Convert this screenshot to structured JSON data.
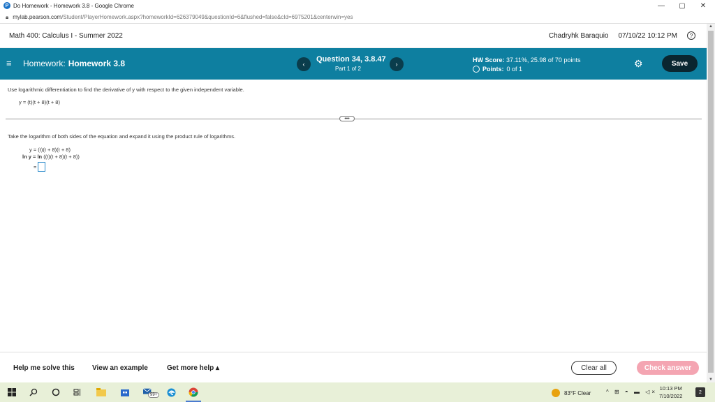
{
  "browser": {
    "window_title": "Do Homework - Homework 3.8 - Google Chrome",
    "url_domain": "mylab.pearson.com",
    "url_path": "/Student/PlayerHomework.aspx?homeworkId=626379049&questionId=6&flushed=false&cId=6975201&centerwin=yes",
    "minimize": "—",
    "restore": "▢",
    "close": "✕"
  },
  "course": {
    "name": "Math 400: Calculus I - Summer 2022",
    "user": "Chadryhk Baraquio",
    "datetime": "07/10/22 10:12 PM",
    "help": "?"
  },
  "header": {
    "menu_icon": "≡",
    "hw_prefix": "Homework:",
    "hw_name": "Homework 3.8",
    "prev": "‹",
    "next": "›",
    "question": "Question 34, 3.8.47",
    "part": "Part 1 of 2",
    "score_label": "HW Score:",
    "score_value": "37.11%, 25.98 of 70 points",
    "points_label": "Points:",
    "points_value": "0 of 1",
    "gear": "⚙",
    "save": "Save"
  },
  "question": {
    "instruction": "Use logarithmic differentiation to find the derivative of y with respect to the given independent variable.",
    "equation": "y = (t)(t + 8)(t + 8)",
    "expand_handle": "•••",
    "step_instruction": "Take the logarithm of both sides of the equation and expand it using the product rule of logarithms.",
    "line1": "y = (t)(t + 8)(t + 8)",
    "line2_prefix": "ln y = ",
    "line2_ln": "ln",
    "line2_rest": " ((t)(t + 8)(t + 8))",
    "line3": "="
  },
  "footer": {
    "help_solve": "Help me solve this",
    "view_example": "View an example",
    "more_help": "Get more help ▴",
    "clear_all": "Clear all",
    "check_answer": "Check answer"
  },
  "taskbar": {
    "weather": "83°F Clear",
    "tray": "^ ⊞ ◓ ▬ ◁×",
    "time": "10:13 PM",
    "date": "7/10/2022",
    "notifications": "2",
    "badge": "99+"
  },
  "colors": {
    "header_bg": "#0e7fa0",
    "save_bg": "#0a2630",
    "check_answer_bg": "#f4a5b2",
    "answer_box_border": "#2a8acb"
  }
}
